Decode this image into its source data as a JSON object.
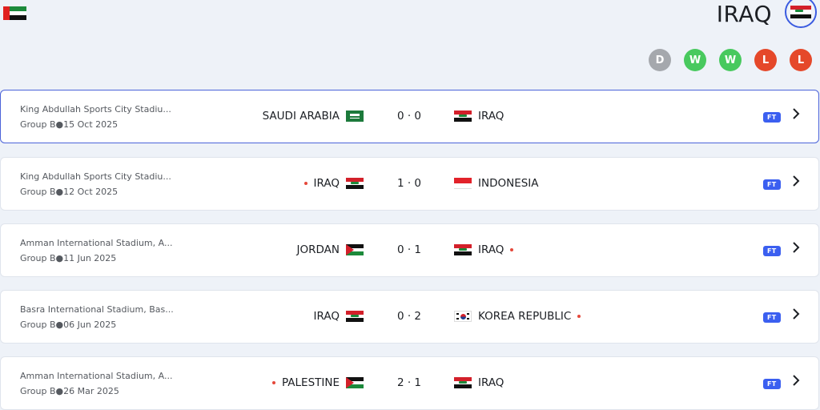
{
  "header": {
    "team_title": "IRAQ",
    "form": [
      {
        "result": "D",
        "color": "#a5a8ad"
      },
      {
        "result": "W",
        "color": "#48c95e"
      },
      {
        "result": "W",
        "color": "#48c95e"
      },
      {
        "result": "L",
        "color": "#e5482a"
      },
      {
        "result": "L",
        "color": "#e5482a"
      }
    ]
  },
  "matches": [
    {
      "venue": "King Abdullah Sports City Stadiu...",
      "group": "Group B●15 Oct 2025",
      "home": "SAUDI ARABIA",
      "home_flag": "ksa",
      "score": "0 · 0",
      "away": "IRAQ",
      "away_flag": "iraq",
      "status": "FT",
      "home_dot": false,
      "away_dot": false
    },
    {
      "venue": "King Abdullah Sports City Stadiu...",
      "group": "Group B●12 Oct 2025",
      "home": "IRAQ",
      "home_flag": "iraq",
      "score": "1 · 0",
      "away": "INDONESIA",
      "away_flag": "indo",
      "status": "FT",
      "home_dot": true,
      "away_dot": false
    },
    {
      "venue": "Amman International Stadium, A...",
      "group": "Group B●11 Jun 2025",
      "home": "JORDAN",
      "home_flag": "jordan",
      "score": "0 · 1",
      "away": "IRAQ",
      "away_flag": "iraq",
      "status": "FT",
      "home_dot": false,
      "away_dot": true
    },
    {
      "venue": "Basra International Stadium, Bas...",
      "group": "Group B●06 Jun 2025",
      "home": "IRAQ",
      "home_flag": "iraq",
      "score": "0 · 2",
      "away": "KOREA REPUBLIC",
      "away_flag": "korea",
      "status": "FT",
      "home_dot": false,
      "away_dot": true
    },
    {
      "venue": "Amman International Stadium, A...",
      "group": "Group B●26 Mar 2025",
      "home": "PALESTINE",
      "home_flag": "pal",
      "score": "2 · 1",
      "away": "IRAQ",
      "away_flag": "iraq",
      "status": "FT",
      "home_dot": true,
      "away_dot": false
    }
  ]
}
